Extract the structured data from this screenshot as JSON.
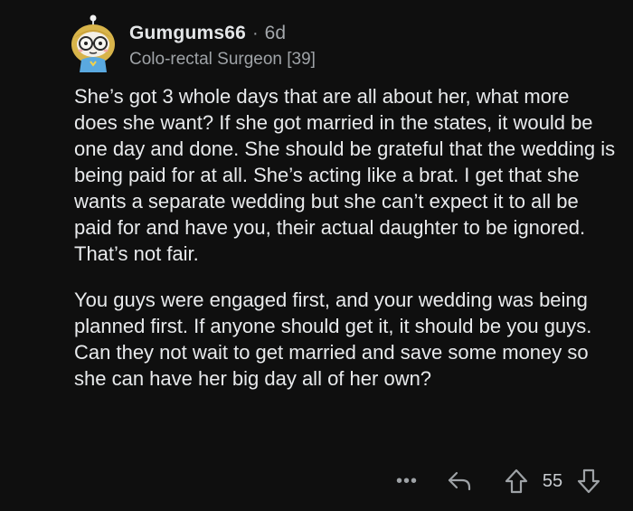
{
  "comment": {
    "author": {
      "username": "Gumgums66",
      "separator": "·",
      "age": "6d",
      "flair": "Colo-rectal Surgeon [39]",
      "avatar_icon": "snoo-avatar-icon"
    },
    "body": {
      "paragraphs": [
        "She’s got 3 whole days that are all about her, what more does she want? If she got married in the states, it would be one day and done. She should be grateful that the wedding is being paid for at all. She’s acting like a brat. I get that she wants a separate wedding but she can’t expect it to all be paid for and have you, their actual daughter to be ignored. That’s not fair.",
        "You guys were engaged first, and your wedding was being planned first. If anyone should get it, it should be you guys. Can they not wait to get married and save some money so she can have her big day all of her own?"
      ]
    },
    "actions": {
      "more_label": "•••",
      "reply_icon": "reply-icon",
      "upvote_icon": "upvote-arrow-icon",
      "score": "55",
      "downvote_icon": "downvote-arrow-icon"
    }
  },
  "colors": {
    "background": "#0f0f0f",
    "text": "#e8eaec",
    "muted": "#9ea2a6"
  }
}
